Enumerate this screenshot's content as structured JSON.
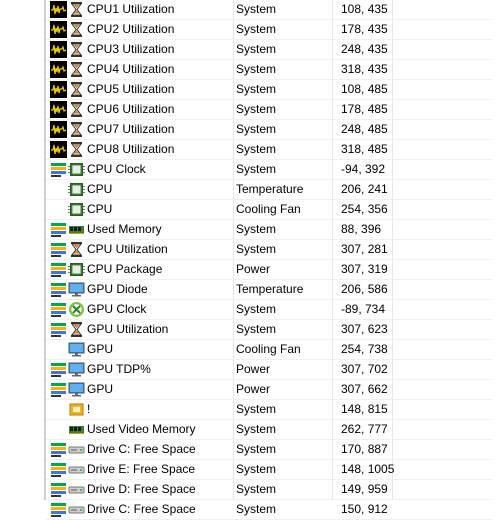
{
  "colors": {
    "grid_line": "#e6e6e6",
    "graph_bg": "#000000",
    "graph_line": "#f0d000",
    "bar_green": "#00a651",
    "bar_yellow": "#f7b500",
    "bar_blue": "#3b78d8",
    "hourglass_orange": "#d9771b",
    "chip_green": "#4a8f3a"
  },
  "rows": [
    {
      "tray": "graph-icon",
      "kind": "hourglass-icon",
      "name": "CPU1 Utilization",
      "source": "System",
      "value": "108, 435"
    },
    {
      "tray": "graph-icon",
      "kind": "hourglass-icon",
      "name": "CPU2 Utilization",
      "source": "System",
      "value": "178, 435"
    },
    {
      "tray": "graph-icon",
      "kind": "hourglass-icon",
      "name": "CPU3 Utilization",
      "source": "System",
      "value": "248, 435"
    },
    {
      "tray": "graph-icon",
      "kind": "hourglass-icon",
      "name": "CPU4 Utilization",
      "source": "System",
      "value": "318, 435"
    },
    {
      "tray": "graph-icon",
      "kind": "hourglass-icon",
      "name": "CPU5 Utilization",
      "source": "System",
      "value": "108, 485"
    },
    {
      "tray": "graph-icon",
      "kind": "hourglass-icon",
      "name": "CPU6 Utilization",
      "source": "System",
      "value": "178, 485"
    },
    {
      "tray": "graph-icon",
      "kind": "hourglass-icon",
      "name": "CPU7 Utilization",
      "source": "System",
      "value": "248, 485"
    },
    {
      "tray": "graph-icon",
      "kind": "hourglass-icon",
      "name": "CPU8 Utilization",
      "source": "System",
      "value": "318, 485"
    },
    {
      "tray": "bars-icon",
      "kind": "cpu-chip-icon",
      "name": "CPU Clock",
      "source": "System",
      "value": "-94, 392"
    },
    {
      "tray": "",
      "kind": "cpu-chip-icon",
      "name": "CPU",
      "source": "Temperature",
      "value": "206, 241"
    },
    {
      "tray": "",
      "kind": "cpu-chip-icon",
      "name": "CPU",
      "source": "Cooling Fan",
      "value": "254, 356"
    },
    {
      "tray": "bars-icon",
      "kind": "memory-icon",
      "name": "Used Memory",
      "source": "System",
      "value": "88, 396"
    },
    {
      "tray": "bars-icon",
      "kind": "hourglass-icon",
      "name": "CPU Utilization",
      "source": "System",
      "value": "307, 281"
    },
    {
      "tray": "bars-icon",
      "kind": "cpu-chip-icon",
      "name": "CPU Package",
      "source": "Power",
      "value": "307, 319"
    },
    {
      "tray": "bars-icon",
      "kind": "monitor-icon",
      "name": "GPU Diode",
      "source": "Temperature",
      "value": "206, 586"
    },
    {
      "tray": "bars-icon",
      "kind": "xbox-icon",
      "name": "GPU Clock",
      "source": "System",
      "value": "-89, 734"
    },
    {
      "tray": "bars-icon",
      "kind": "hourglass-icon",
      "name": "GPU Utilization",
      "source": "System",
      "value": "307, 623"
    },
    {
      "tray": "",
      "kind": "monitor-icon",
      "name": "GPU",
      "source": "Cooling Fan",
      "value": "254, 738"
    },
    {
      "tray": "bars-icon",
      "kind": "monitor-icon",
      "name": "GPU TDP%",
      "source": "Power",
      "value": "307, 702"
    },
    {
      "tray": "bars-icon",
      "kind": "monitor-icon",
      "name": "GPU",
      "source": "Power",
      "value": "307, 662"
    },
    {
      "tray": "",
      "kind": "gpu-chip-icon",
      "name": "!",
      "source": "System",
      "value": "148, 815"
    },
    {
      "tray": "",
      "kind": "memory-icon",
      "name": "Used Video Memory",
      "source": "System",
      "value": "262, 777"
    },
    {
      "tray": "bars-icon",
      "kind": "drive-icon",
      "name": "Drive C: Free Space",
      "source": "System",
      "value": "170, 887"
    },
    {
      "tray": "bars-icon",
      "kind": "drive-icon",
      "name": "Drive E: Free Space",
      "source": "System",
      "value": "148, 1005"
    },
    {
      "tray": "bars-icon",
      "kind": "drive-icon",
      "name": "Drive D: Free Space",
      "source": "System",
      "value": "149, 959"
    },
    {
      "tray": "bars-icon",
      "kind": "drive-icon",
      "name": "Drive C: Free Space",
      "source": "System",
      "value": "150, 912"
    }
  ]
}
